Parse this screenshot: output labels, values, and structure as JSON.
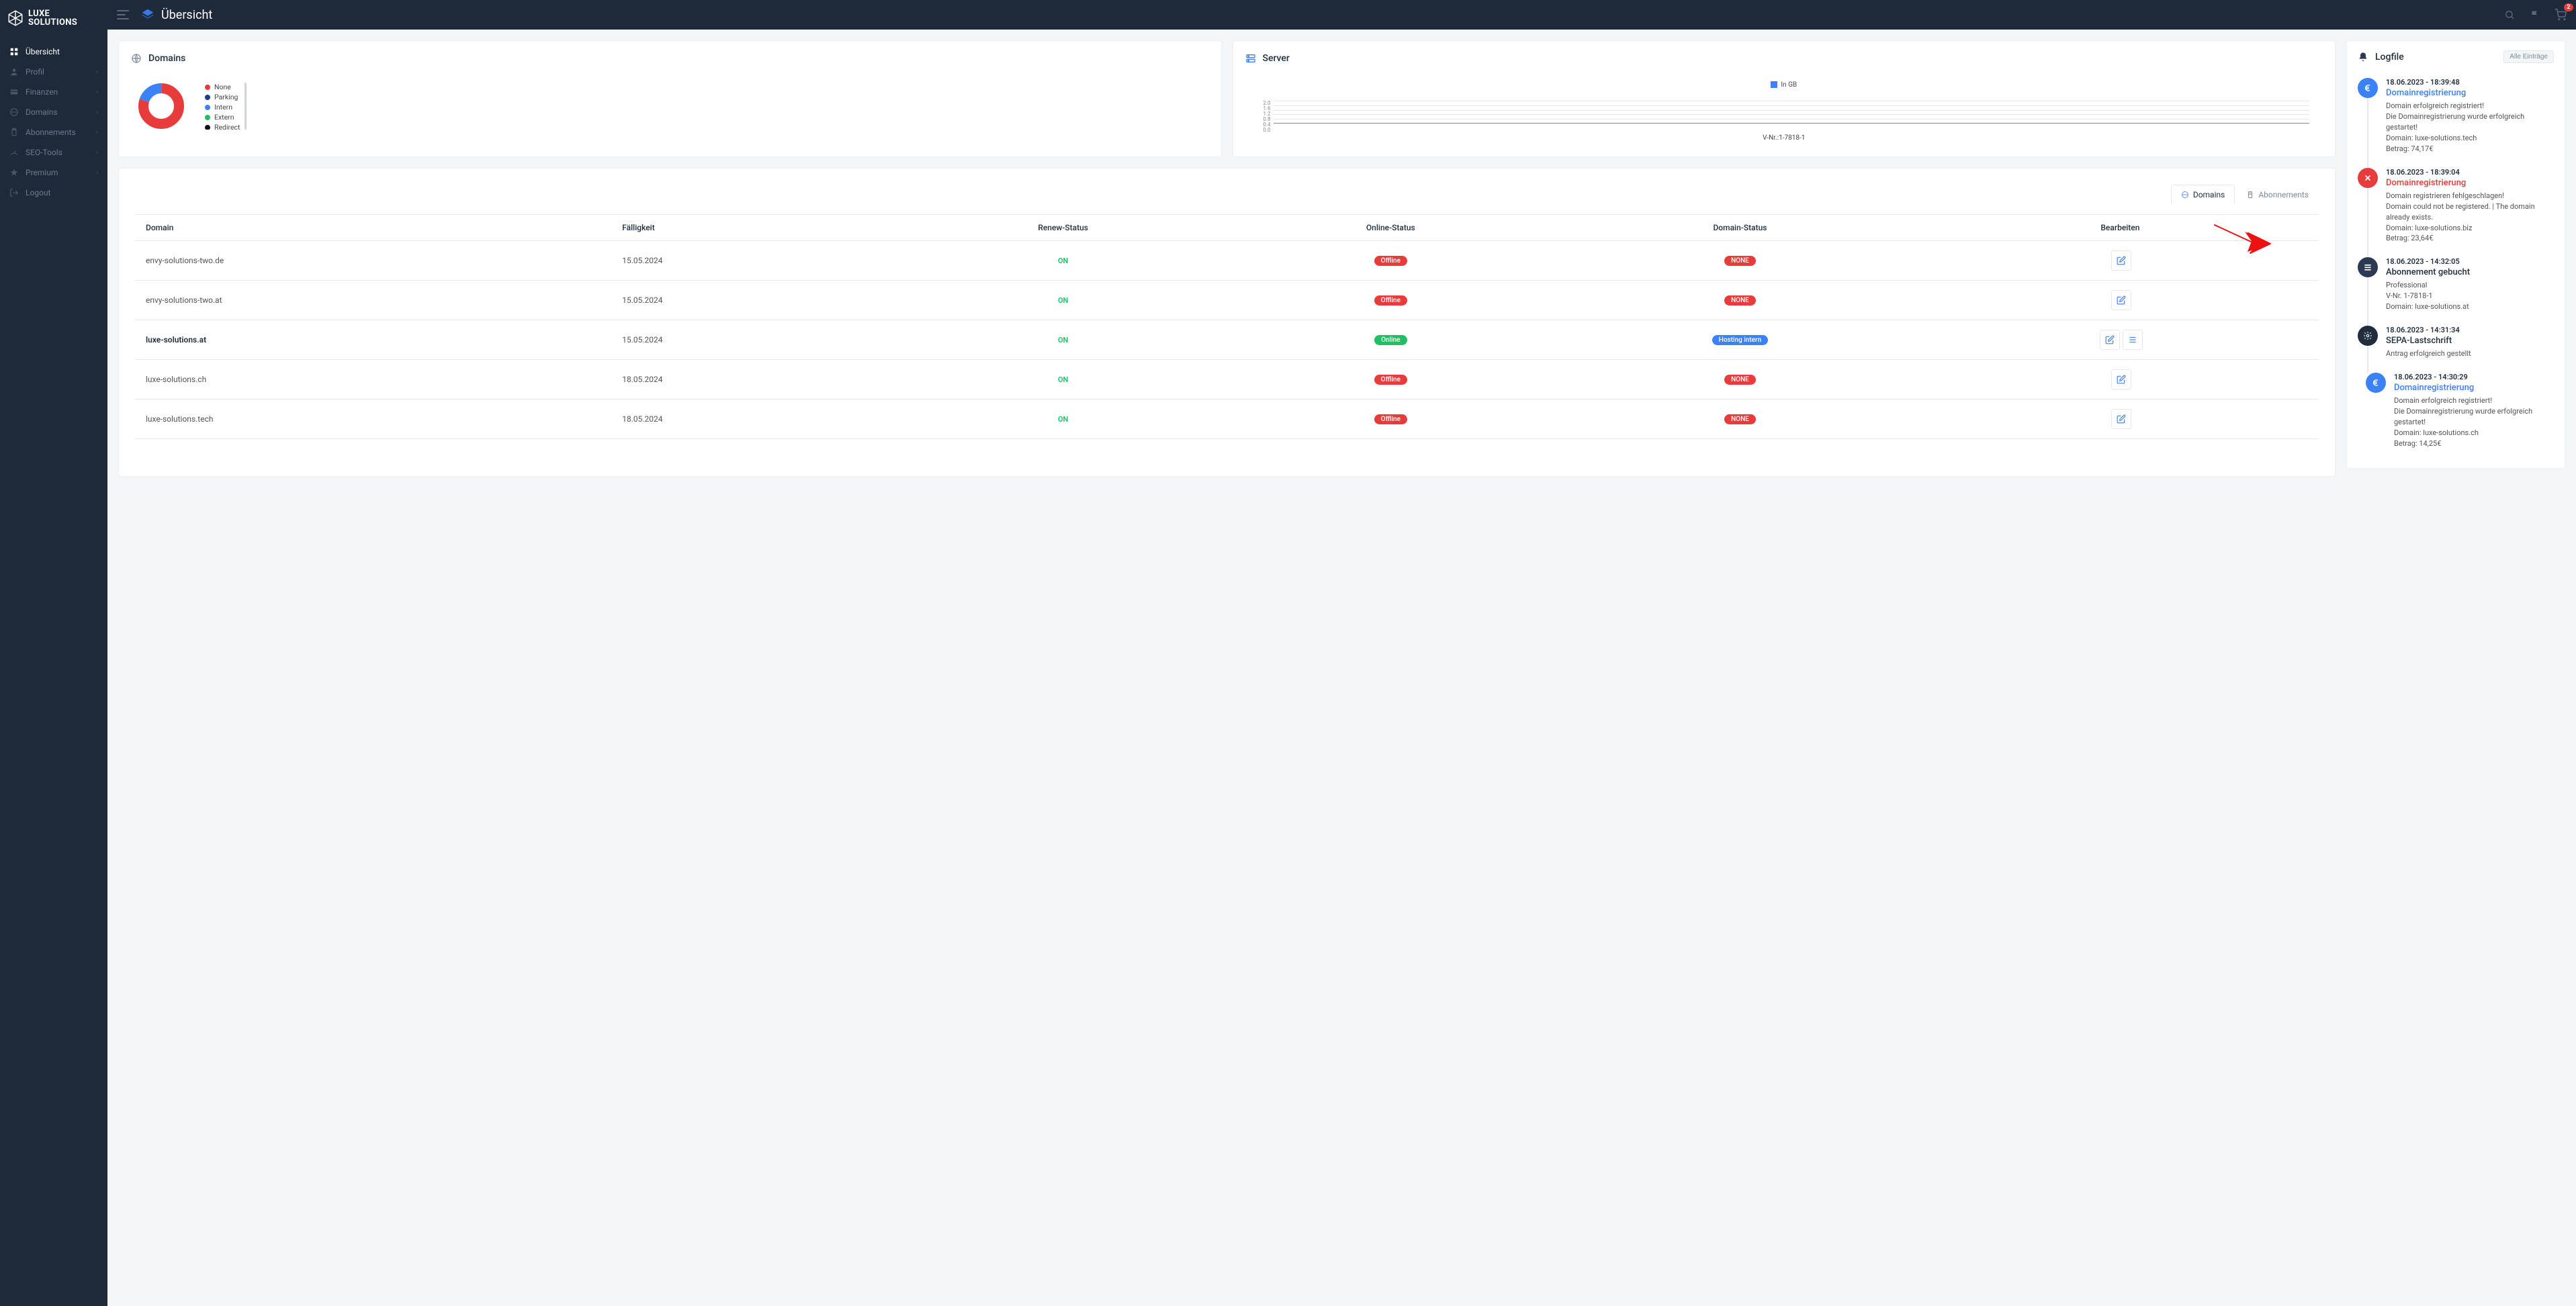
{
  "brand": "LUXE SOLUTIONS",
  "page_title": "Übersicht",
  "topbar": {
    "cart_badge": "2"
  },
  "sidebar": {
    "items": [
      {
        "label": "Übersicht",
        "icon": "dashboard",
        "active": true,
        "chev": false
      },
      {
        "label": "Profil",
        "icon": "user",
        "active": false,
        "chev": true
      },
      {
        "label": "Finanzen",
        "icon": "card",
        "active": false,
        "chev": true
      },
      {
        "label": "Domains",
        "icon": "globe",
        "active": false,
        "chev": true
      },
      {
        "label": "Abonnements",
        "icon": "clip",
        "active": false,
        "chev": true
      },
      {
        "label": "SEO-Tools",
        "icon": "gauge",
        "active": false,
        "chev": true
      },
      {
        "label": "Premium",
        "icon": "star",
        "active": false,
        "chev": true
      },
      {
        "label": "Logout",
        "icon": "logout",
        "active": false,
        "chev": false
      }
    ]
  },
  "domains_card": {
    "title": "Domains",
    "legend": [
      {
        "label": "None",
        "color": "#e83c3c"
      },
      {
        "label": "Parking",
        "color": "#1e3a8a"
      },
      {
        "label": "Intern",
        "color": "#3b82f6"
      },
      {
        "label": "Extern",
        "color": "#1fbf63"
      },
      {
        "label": "Redirect",
        "color": "#111111"
      }
    ]
  },
  "server_card": {
    "title": "Server",
    "legend": "In GB",
    "yaxis": [
      "2.0",
      "1.6",
      "1.2",
      "0.8",
      "0.4",
      "0.0"
    ],
    "xaxis": "V-Nr.:1-7818-1"
  },
  "tabs": {
    "domains": "Domains",
    "abos": "Abonnements"
  },
  "table": {
    "headers": {
      "domain": "Domain",
      "due": "Fälligkeit",
      "renew": "Renew-Status",
      "online": "Online-Status",
      "dstatus": "Domain-Status",
      "edit": "Bearbeiten"
    },
    "rows": [
      {
        "domain": "envy-solutions-two.de",
        "due": "15.05.2024",
        "renew": "ON",
        "online": "Offline",
        "online_cls": "red",
        "dstatus": "NONE",
        "dstatus_cls": "red",
        "bold": false,
        "extra": false
      },
      {
        "domain": "envy-solutions-two.at",
        "due": "15.05.2024",
        "renew": "ON",
        "online": "Offline",
        "online_cls": "red",
        "dstatus": "NONE",
        "dstatus_cls": "red",
        "bold": false,
        "extra": false
      },
      {
        "domain": "luxe-solutions.at",
        "due": "15.05.2024",
        "renew": "ON",
        "online": "Online",
        "online_cls": "green",
        "dstatus": "Hosting intern",
        "dstatus_cls": "blue",
        "bold": true,
        "extra": true
      },
      {
        "domain": "luxe-solutions.ch",
        "due": "18.05.2024",
        "renew": "ON",
        "online": "Offline",
        "online_cls": "red",
        "dstatus": "NONE",
        "dstatus_cls": "red",
        "bold": false,
        "extra": false
      },
      {
        "domain": "luxe-solutions.tech",
        "due": "18.05.2024",
        "renew": "ON",
        "online": "Offline",
        "online_cls": "red",
        "dstatus": "NONE",
        "dstatus_cls": "red",
        "bold": false,
        "extra": false
      }
    ]
  },
  "logfile": {
    "title": "Logfile",
    "all_btn": "Alle Einträge",
    "items": [
      {
        "icon": "euro",
        "icon_cls": "blue",
        "time": "18.06.2023 - 18:39:48",
        "title": "Domainregistrierung",
        "title_cls": "blue",
        "desc": "Domain erfolgreich registriert!\nDie Domainregistrierung wurde erfolgreich gestartet!\nDomain: luxe-solutions.tech\nBetrag: 74,17€"
      },
      {
        "icon": "x",
        "icon_cls": "red",
        "time": "18.06.2023 - 18:39:04",
        "title": "Domainregistrierung",
        "title_cls": "red",
        "desc": "Domain registrieren fehlgeschlagen!\nDomain could not be registered. | The domain already exists.\nDomain: luxe-solutions.biz\nBetrag: 23,64€"
      },
      {
        "icon": "list",
        "icon_cls": "navy",
        "time": "18.06.2023 - 14:32:05",
        "title": "Abonnement gebucht",
        "title_cls": "dark",
        "desc": "Professional\nV-Nr. 1-7818-1\nDomain: luxe-solutions.at"
      },
      {
        "icon": "gear",
        "icon_cls": "dark",
        "time": "18.06.2023 - 14:31:34",
        "title": "SEPA-Lastschrift",
        "title_cls": "dark",
        "desc": "Antrag erfolgreich gestellt"
      },
      {
        "icon": "euro",
        "icon_cls": "blue",
        "time": "18.06.2023 - 14:30:29",
        "title": "Domainregistrierung",
        "title_cls": "blue",
        "desc": "Domain erfolgreich registriert!\nDie Domainregistrierung wurde erfolgreich gestartet!\nDomain: luxe-solutions.ch\nBetrag: 14,25€"
      }
    ]
  },
  "chart_data": {
    "type": "pie",
    "title": "Domains",
    "series": [
      {
        "name": "None",
        "value": 4,
        "color": "#e83c3c"
      },
      {
        "name": "Parking",
        "value": 0,
        "color": "#1e3a8a"
      },
      {
        "name": "Intern",
        "value": 1,
        "color": "#3b82f6"
      },
      {
        "name": "Extern",
        "value": 0,
        "color": "#1fbf63"
      },
      {
        "name": "Redirect",
        "value": 0,
        "color": "#111111"
      }
    ]
  }
}
